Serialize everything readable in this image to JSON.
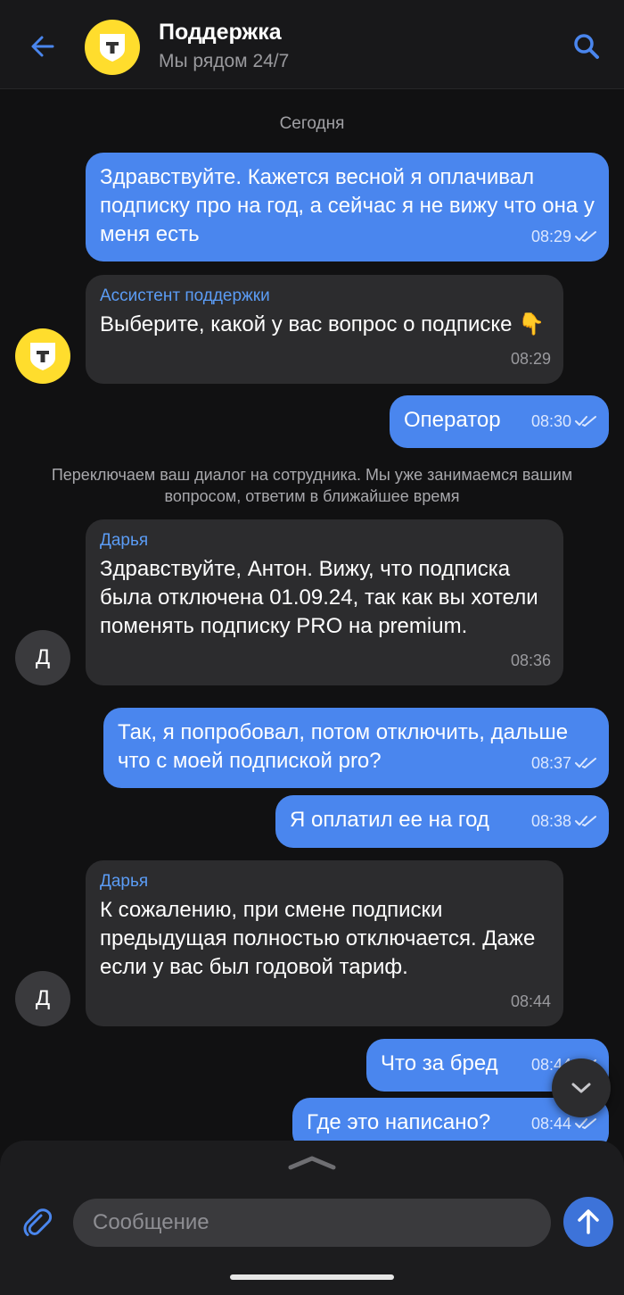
{
  "header": {
    "title": "Поддержка",
    "subtitle": "Мы рядом 24/7",
    "icons": {
      "back": "arrow-left-icon",
      "search": "search-icon",
      "logo": "t-brand-logo-icon"
    }
  },
  "colors": {
    "accent": "#4a86ee",
    "brand_yellow": "#ffdd2d",
    "incoming_bubble": "#2c2c2e",
    "background": "#111112"
  },
  "chat": {
    "date_separator": "Сегодня",
    "system_message": "Переключаем ваш диалог на сотрудника. Мы уже занимаемся вашим вопросом, ответим в ближайшее время",
    "messages": [
      {
        "direction": "out",
        "text": "Здравствуйте. Кажется весной я оплачивал подписку про на год, а сейчас я не вижу что она у меня есть",
        "time": "08:29",
        "status": "read"
      },
      {
        "direction": "in",
        "sender": "Ассистент поддержки",
        "text": "Выберите, какой у вас вопрос о подписке 👇",
        "time": "08:29"
      },
      {
        "direction": "out",
        "text": "Оператор",
        "time": "08:30",
        "status": "read"
      },
      {
        "direction": "in",
        "sender": "Дарья",
        "avatar_letter": "Д",
        "text": "Здравствуйте, Антон. Вижу, что подписка была отключена 01.09.24, так как вы хотели поменять подписку PRO на premium.",
        "time": "08:36"
      },
      {
        "direction": "out",
        "text": "Так, я попробовал, потом отключить, дальше что с моей подпиской pro?",
        "time": "08:37",
        "status": "read"
      },
      {
        "direction": "out",
        "text": "Я оплатил ее на год",
        "time": "08:38",
        "status": "read"
      },
      {
        "direction": "in",
        "sender": "Дарья",
        "avatar_letter": "Д",
        "text": "К сожалению, при смене подписки предыдущая полностью отключается. Даже если у вас был годовой тариф.",
        "time": "08:44"
      },
      {
        "direction": "out",
        "text": "Что за бред",
        "time": "08:44",
        "status": "read"
      },
      {
        "direction": "out",
        "text": "Где это написано?",
        "time": "08:44",
        "status": "read"
      }
    ]
  },
  "composer": {
    "placeholder": "Сообщение",
    "icons": {
      "attach": "paperclip-icon",
      "send": "arrow-up-icon",
      "scroll_down": "chevron-down-icon",
      "expand": "chevron-up-icon"
    }
  }
}
